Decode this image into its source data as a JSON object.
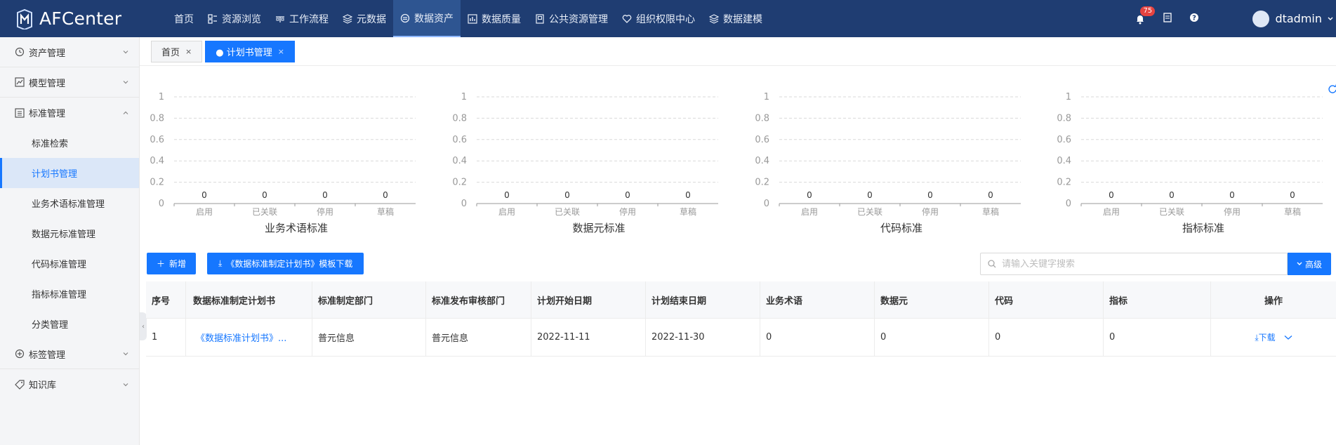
{
  "app": {
    "title": "AFCenter"
  },
  "nav": {
    "items": [
      {
        "label": "首页",
        "icon": "none"
      },
      {
        "label": "资源浏览",
        "icon": "grid-list-icon"
      },
      {
        "label": "工作流程",
        "icon": "workflow-icon"
      },
      {
        "label": "元数据",
        "icon": "layers-icon"
      },
      {
        "label": "数据资产",
        "icon": "asset-icon",
        "active": true
      },
      {
        "label": "数据质量",
        "icon": "bar-chart-icon"
      },
      {
        "label": "公共资源管理",
        "icon": "folder-icon"
      },
      {
        "label": "组织权限中心",
        "icon": "shield-icon"
      },
      {
        "label": "数据建模",
        "icon": "layers-icon"
      }
    ]
  },
  "header_right": {
    "notification_count": "75",
    "username": "dtadmin"
  },
  "sidebar": {
    "groups_top": [
      {
        "label": "资产管理"
      },
      {
        "label": "模型管理"
      },
      {
        "label": "标准管理"
      }
    ],
    "sub_items": [
      {
        "label": "标准检索"
      },
      {
        "label": "计划书管理",
        "active": true
      },
      {
        "label": "业务术语标准管理"
      },
      {
        "label": "数据元标准管理"
      },
      {
        "label": "代码标准管理"
      },
      {
        "label": "指标标准管理"
      },
      {
        "label": "分类管理"
      }
    ],
    "groups_bottom": [
      {
        "label": "标签管理"
      },
      {
        "label": "知识库"
      }
    ]
  },
  "tabs": [
    {
      "label": "首页",
      "close": "×"
    },
    {
      "label": "● 计划书管理",
      "close": "×",
      "active": true
    }
  ],
  "chart_data": [
    {
      "type": "bar",
      "title": "业务术语标准",
      "categories": [
        "启用",
        "已关联",
        "停用",
        "草稿"
      ],
      "values": [
        0,
        0,
        0,
        0
      ],
      "ylim": [
        0,
        1
      ],
      "yticks": [
        "0",
        "0.2",
        "0.4",
        "0.6",
        "0.8",
        "1"
      ],
      "grid": true
    },
    {
      "type": "bar",
      "title": "数据元标准",
      "categories": [
        "启用",
        "已关联",
        "停用",
        "草稿"
      ],
      "values": [
        0,
        0,
        0,
        0
      ],
      "ylim": [
        0,
        1
      ],
      "yticks": [
        "0",
        "0.2",
        "0.4",
        "0.6",
        "0.8",
        "1"
      ],
      "grid": true
    },
    {
      "type": "bar",
      "title": "代码标准",
      "categories": [
        "启用",
        "已关联",
        "停用",
        "草稿"
      ],
      "values": [
        0,
        0,
        0,
        0
      ],
      "ylim": [
        0,
        1
      ],
      "yticks": [
        "0",
        "0.2",
        "0.4",
        "0.6",
        "0.8",
        "1"
      ],
      "grid": true
    },
    {
      "type": "bar",
      "title": "指标标准",
      "categories": [
        "启用",
        "已关联",
        "停用",
        "草稿"
      ],
      "values": [
        0,
        0,
        0,
        0
      ],
      "ylim": [
        0,
        1
      ],
      "yticks": [
        "0",
        "0.2",
        "0.4",
        "0.6",
        "0.8",
        "1"
      ],
      "grid": true
    }
  ],
  "toolbar": {
    "add_label": "新增",
    "download_template_label": "《数据标准制定计划书》模板下载",
    "search_placeholder": "请输入关键字搜索",
    "advanced_label": "高级"
  },
  "table": {
    "headers": [
      "序号",
      "数据标准制定计划书",
      "标准制定部门",
      "标准发布审核部门",
      "计划开始日期",
      "计划结束日期",
      "业务术语",
      "数据元",
      "代码",
      "指标",
      "操作"
    ],
    "rows": [
      {
        "cells": [
          "1",
          "《数据标准计划书》...",
          "普元信息",
          "普元信息",
          "2022-11-11",
          "2022-11-30",
          "0",
          "0",
          "0",
          "0"
        ],
        "ops": {
          "download": "下载"
        }
      }
    ]
  },
  "colors": {
    "nav_bg": "#1f3d72",
    "accent": "#1677ff",
    "badge": "#e64340"
  }
}
